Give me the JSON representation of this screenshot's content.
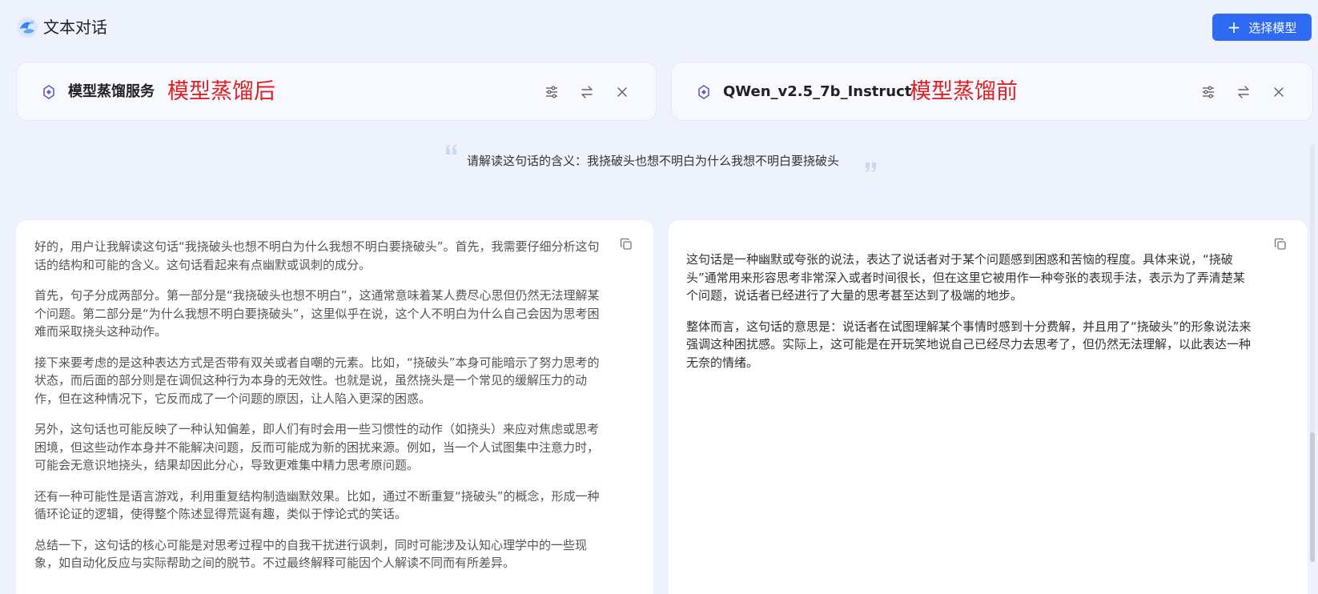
{
  "header": {
    "title": "文本对话",
    "select_model_label": "选择模型"
  },
  "models": {
    "left": {
      "name": "模型蒸馏服务",
      "tag": "模型蒸馏后"
    },
    "right": {
      "name": "QWen_v2.5_7b_Instruct",
      "tag": "模型蒸馏前"
    }
  },
  "prompt": "请解读这句话的含义：我挠破头也想不明白为什么我想不明白要挠破头",
  "answers": {
    "left": [
      "好的，用户让我解读这句话“我挠破头也想不明白为什么我想不明白要挠破头”。首先，我需要仔细分析这句话的结构和可能的含义。这句话看起来有点幽默或讽刺的成分。",
      "首先，句子分成两部分。第一部分是“我挠破头也想不明白”，这通常意味着某人费尽心思但仍然无法理解某个问题。第二部分是“为什么我想不明白要挠破头”，这里似乎在说，这个人不明白为什么自己会因为思考困难而采取挠头这种动作。",
      "接下来要考虑的是这种表达方式是否带有双关或者自嘲的元素。比如，“挠破头”本身可能暗示了努力思考的状态，而后面的部分则是在调侃这种行为本身的无效性。也就是说，虽然挠头是一个常见的缓解压力的动作，但在这种情况下，它反而成了一个问题的原因，让人陷入更深的困惑。",
      "另外，这句话也可能反映了一种认知偏差，即人们有时会用一些习惯性的动作（如挠头）来应对焦虑或思考困境，但这些动作本身并不能解决问题，反而可能成为新的困扰来源。例如，当一个人试图集中注意力时，可能会无意识地挠头，结果却因此分心，导致更难集中精力思考原问题。",
      "还有一种可能性是语言游戏，利用重复结构制造幽默效果。比如，通过不断重复“挠破头”的概念，形成一种循环论证的逻辑，使得整个陈述显得荒诞有趣，类似于悖论式的笑话。",
      "总结一下，这句话的核心可能是对思考过程中的自我干扰进行讽刺，同时可能涉及认知心理学中的一些现象，如自动化反应与实际帮助之间的脱节。不过最终解释可能因个人解读不同而有所差异。"
    ],
    "right": [
      "这句话是一种幽默或夸张的说法，表达了说话者对于某个问题感到困惑和苦恼的程度。具体来说，“挠破头”通常用来形容思考非常深入或者时间很长，但在这里它被用作一种夸张的表现手法，表示为了弄清楚某个问题，说话者已经进行了大量的思考甚至达到了极端的地步。",
      "整体而言，这句话的意思是：说话者在试图理解某个事情时感到十分费解，并且用了“挠破头”的形象说法来强调这种困扰感。实际上，这可能是在开玩笑地说自己已经尽力去思考了，但仍然无法理解，以此表达一种无奈的情绪。"
    ]
  },
  "colors": {
    "accent": "#2f6bf2",
    "tag_red": "#e02020",
    "background": "#eef2fc"
  },
  "icons": [
    "app-logo-icon",
    "plus-icon",
    "model-icon",
    "settings-sliders-icon",
    "swap-icon",
    "close-icon",
    "copy-icon",
    "quote-open-icon",
    "quote-close-icon"
  ]
}
